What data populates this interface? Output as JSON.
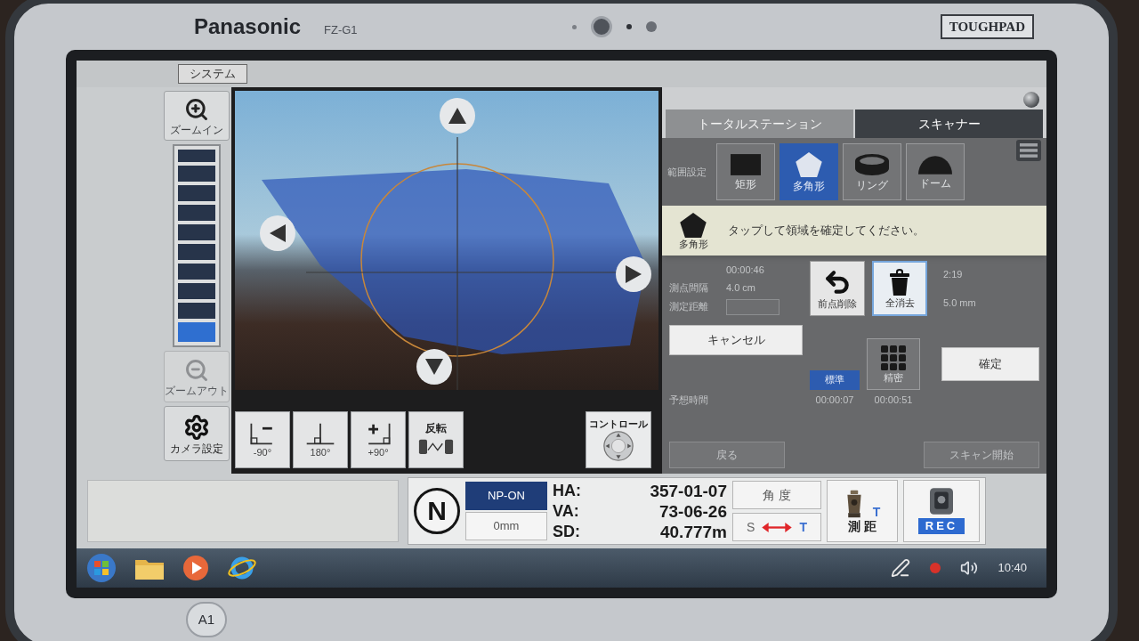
{
  "device": {
    "brand": "Panasonic",
    "model": "FZ-G1",
    "badge": "TOUGHPAD",
    "hardware_button": "A1"
  },
  "app": {
    "system_button": "システム",
    "zoom": {
      "zoom_in": "ズームイン",
      "level": 0.1,
      "zoom_out": "ズームアウト"
    },
    "camera_settings": "カメラ設定",
    "rotation_buttons": [
      {
        "kind": "minus90",
        "label": "-90°"
      },
      {
        "kind": "flip180",
        "label": "180°"
      },
      {
        "kind": "plus90",
        "label": "+90°"
      },
      {
        "kind": "reverse",
        "label": "反転"
      }
    ],
    "control_button": "コントロール",
    "tabs": [
      {
        "label": "トータルステーション",
        "selected": false
      },
      {
        "label": "スキャナー",
        "selected": true
      }
    ],
    "range_setting": {
      "label": "範囲設定",
      "shapes": [
        {
          "kind": "rectangle",
          "label": "矩形",
          "selected": false
        },
        {
          "kind": "polygon",
          "label": "多角形",
          "selected": true
        },
        {
          "kind": "ring",
          "label": "リング",
          "selected": false
        },
        {
          "kind": "dome",
          "label": "ドーム",
          "selected": false
        }
      ]
    },
    "popup": {
      "shape_label": "多角形",
      "message": "タップして領域を確定してください。"
    },
    "scan_settings": {
      "estimate": "00:00:46",
      "interval_label": "測点間隔",
      "interval": "4.0 cm",
      "distance_label": "測定距離",
      "time_right": "2:19",
      "value_right": "5.0 mm"
    },
    "point_buttons": [
      {
        "kind": "undo",
        "label": "前点削除",
        "selected": false
      },
      {
        "kind": "trash",
        "label": "全消去",
        "selected": true
      }
    ],
    "cancel_button": "キャンセル",
    "time_label": "予想時間",
    "density": [
      {
        "kind": "plain",
        "label": "標準",
        "selected": true,
        "time": "00:00:07"
      },
      {
        "kind": "grid",
        "label": "精密",
        "selected": false,
        "time": "00:00:51"
      }
    ],
    "confirm_button": "確定",
    "back_button": "戻る",
    "scan_start_button": "スキャン開始",
    "compass": "N",
    "prism": {
      "mode": "NP-ON",
      "offset": "0mm"
    },
    "readings": [
      {
        "label": "HA:",
        "value": "357-01-07"
      },
      {
        "label": "VA:",
        "value": "73-06-26"
      },
      {
        "label": "SD:",
        "value": "40.777m"
      }
    ],
    "angle_button": "角 度",
    "swap_button": {
      "left": "S",
      "right": "T"
    },
    "measure_button": {
      "label": "測 距",
      "target": "T"
    },
    "record_button": "REC"
  },
  "taskbar": {
    "clock": "10:40"
  }
}
